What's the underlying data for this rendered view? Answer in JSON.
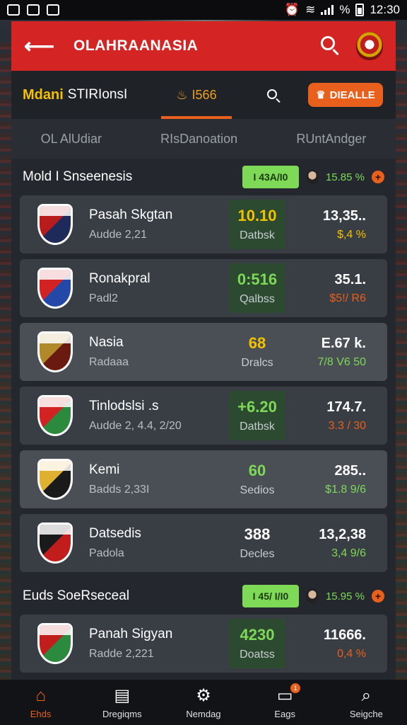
{
  "status_bar": {
    "time": "12:30",
    "battery_pct": "%"
  },
  "header": {
    "title": "OLAHRAANASIA"
  },
  "subheader": {
    "brand_a": "Mdani",
    "brand_b": "STIRIonsI",
    "active_tab": "I566",
    "button_label": "DIEALLE"
  },
  "tabs": [
    "OL AlUdiar",
    "RIsDanoation",
    "RUntAndger"
  ],
  "section1": {
    "title": "Mold I Snseenesis",
    "pill": "I 43A/I0",
    "pct": "15.85 %"
  },
  "section2": {
    "title": "Euds SoeRseceal",
    "pill": "I 45/ I/I0",
    "pct": "15.95 %"
  },
  "teams": [
    {
      "name": "Pasah Skgtan",
      "sub": "Audde 2,21",
      "score": "10.10",
      "score_label": "Datbsk",
      "score_color": "#f2c200",
      "boxed": true,
      "stat": "13,35..",
      "change": "$,4 %",
      "change_color": "#f2c200",
      "colors": [
        "#b81c1c",
        "#1e2a5a"
      ]
    },
    {
      "name": "Ronakpral",
      "sub": "Padl2",
      "score": "0:516",
      "score_label": "Qalbss",
      "score_color": "#7ed957",
      "boxed": true,
      "stat": "35.1.",
      "change": "$5!/ R6",
      "change_color": "#e8601c",
      "colors": [
        "#d22222",
        "#2448a8"
      ]
    },
    {
      "name": "Nasia",
      "sub": "Radaaa",
      "score": "68",
      "score_label": "Dralcs",
      "score_color": "#f2c200",
      "boxed": false,
      "stat": "E.67 k.",
      "change": "7/8 V6 50",
      "change_color": "#7ed957",
      "colors": [
        "#b08a2a",
        "#6b1a10"
      ]
    },
    {
      "name": "Tinlodslsi .s",
      "sub": "Audde 2, 4.4, 2/20",
      "score": "+6.20",
      "score_label": "Datbsk",
      "score_color": "#7ed957",
      "boxed": true,
      "stat": "174.7.",
      "change": "3.3 / 30",
      "change_color": "#e8601c",
      "colors": [
        "#d22222",
        "#2b8a3e"
      ]
    },
    {
      "name": "Kemi",
      "sub": "Badds 2,33I",
      "score": "60",
      "score_label": "Sedios",
      "score_color": "#7ed957",
      "boxed": false,
      "stat": "285..",
      "change": "$1.8 9/6",
      "change_color": "#7ed957",
      "colors": [
        "#e0b030",
        "#1a1a1a"
      ]
    },
    {
      "name": "Datsedis",
      "sub": "Padola",
      "score": "388",
      "score_label": "Decles",
      "score_color": "#ffffff",
      "boxed": false,
      "stat": "13,2,38",
      "change": "3,4 9/6",
      "change_color": "#7ed957",
      "colors": [
        "#1a1a1a",
        "#c21d1d"
      ]
    },
    {
      "name": "Panah Sigyan",
      "sub": "Radde 2,221",
      "score": "4230",
      "score_label": "Doatss",
      "score_color": "#7ed957",
      "boxed": true,
      "stat": "11666.",
      "change": "0,4 %",
      "change_color": "#e8601c",
      "colors": [
        "#c21d1d",
        "#2b8a3e"
      ]
    }
  ],
  "nav": [
    {
      "label": "Ehds",
      "icon": "home-icon",
      "active": true
    },
    {
      "label": "Dregiqms",
      "icon": "chart-icon",
      "active": false
    },
    {
      "label": "Nemdag",
      "icon": "gear-icon",
      "active": false
    },
    {
      "label": "Eags",
      "icon": "messages-icon",
      "active": false,
      "badge": "1"
    },
    {
      "label": "Seigche",
      "icon": "search-icon",
      "active": false
    }
  ]
}
